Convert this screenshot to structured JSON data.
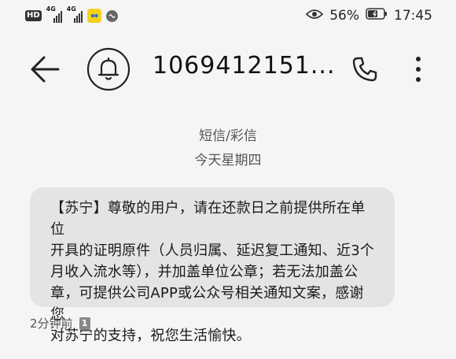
{
  "status_bar": {
    "badge": "HD",
    "network_1": "4G",
    "network_2": "4G",
    "battery_percent": "56%",
    "time": "17:45",
    "icons": [
      "hd-icon",
      "signal-icon",
      "signal-icon",
      "app-notification-icon",
      "recorder-icon",
      "eye-icon",
      "battery-icon"
    ]
  },
  "header": {
    "contact": "1069412151...",
    "icons": [
      "back-arrow-icon",
      "bell-icon",
      "phone-icon",
      "more-vertical-icon"
    ]
  },
  "thread": {
    "message_type": "短信/彩信",
    "date": "今天星期四"
  },
  "message": {
    "lines": [
      "【苏宁】尊敬的用户，请在还款日之前提供所在单位",
      "开具的证明原件（人员归属、延迟复工通知、近3个",
      "月收入流水等），并加盖单位公章；若无法加盖公",
      "章，可提供公司APP或公众号相关通知文案，感谢您",
      "对苏宁的支持，祝您生活愉快。"
    ],
    "time_ago": "2分钟前",
    "sim": "1"
  },
  "colors": {
    "background": "#f5f5f5",
    "bubble": "#e4e4e4",
    "text": "#1a1a1a",
    "muted": "#555555"
  }
}
